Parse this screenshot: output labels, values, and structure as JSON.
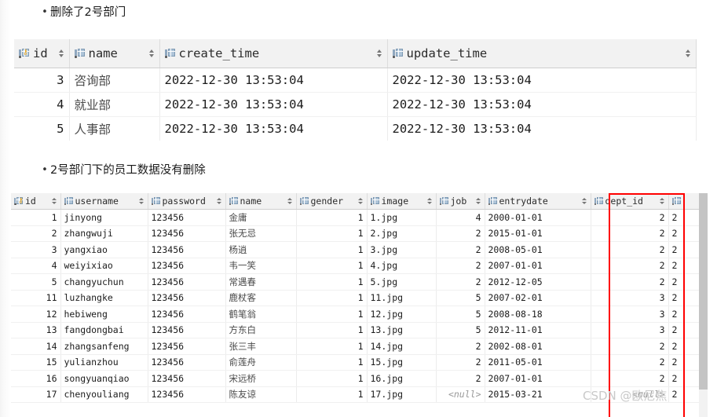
{
  "notes": [
    {
      "text": "删除了2号部门"
    },
    {
      "text": "2号部门下的员工数据没有删除"
    }
  ],
  "dept_table": {
    "columns": [
      {
        "label": "id",
        "icon": "primary-key-column-icon",
        "sortable": true
      },
      {
        "label": "name",
        "icon": "column-icon",
        "sortable": true
      },
      {
        "label": "create_time",
        "icon": "column-icon",
        "sortable": true
      },
      {
        "label": "update_time",
        "icon": "column-icon",
        "sortable": true
      }
    ],
    "rows": [
      {
        "id": "3",
        "name": "咨询部",
        "create_time": "2022-12-30 13:53:04",
        "update_time": "2022-12-30 13:53:04"
      },
      {
        "id": "4",
        "name": "就业部",
        "create_time": "2022-12-30 13:53:04",
        "update_time": "2022-12-30 13:53:04"
      },
      {
        "id": "5",
        "name": "人事部",
        "create_time": "2022-12-30 13:53:04",
        "update_time": "2022-12-30 13:53:04"
      }
    ]
  },
  "emp_table": {
    "columns": [
      {
        "label": "id",
        "icon": "primary-key-column-icon",
        "sortable": true
      },
      {
        "label": "username",
        "icon": "column-icon",
        "sortable": true
      },
      {
        "label": "password",
        "icon": "column-icon",
        "sortable": true
      },
      {
        "label": "name",
        "icon": "column-icon",
        "sortable": true
      },
      {
        "label": "gender",
        "icon": "column-icon",
        "sortable": true
      },
      {
        "label": "image",
        "icon": "column-icon",
        "sortable": true
      },
      {
        "label": "job",
        "icon": "column-icon",
        "sortable": true
      },
      {
        "label": "entrydate",
        "icon": "column-icon",
        "sortable": true
      },
      {
        "label": "dept_id",
        "icon": "column-icon",
        "sortable": true
      }
    ],
    "rows": [
      {
        "id": "1",
        "username": "jinyong",
        "password": "123456",
        "name": "金庸",
        "gender": "1",
        "image": "1.jpg",
        "job": "4",
        "entrydate": "2000-01-01",
        "dept_id": "2",
        "next": "2"
      },
      {
        "id": "2",
        "username": "zhangwuji",
        "password": "123456",
        "name": "张无忌",
        "gender": "1",
        "image": "2.jpg",
        "job": "2",
        "entrydate": "2015-01-01",
        "dept_id": "2",
        "next": "2"
      },
      {
        "id": "3",
        "username": "yangxiao",
        "password": "123456",
        "name": "杨逍",
        "gender": "1",
        "image": "3.jpg",
        "job": "2",
        "entrydate": "2008-05-01",
        "dept_id": "2",
        "next": "2"
      },
      {
        "id": "4",
        "username": "weiyixiao",
        "password": "123456",
        "name": "韦一笑",
        "gender": "1",
        "image": "4.jpg",
        "job": "2",
        "entrydate": "2007-01-01",
        "dept_id": "2",
        "next": "2"
      },
      {
        "id": "5",
        "username": "changyuchun",
        "password": "123456",
        "name": "常遇春",
        "gender": "1",
        "image": "5.jpg",
        "job": "2",
        "entrydate": "2012-12-05",
        "dept_id": "2",
        "next": "2"
      },
      {
        "id": "11",
        "username": "luzhangke",
        "password": "123456",
        "name": "鹿杖客",
        "gender": "1",
        "image": "11.jpg",
        "job": "5",
        "entrydate": "2007-02-01",
        "dept_id": "3",
        "next": "2"
      },
      {
        "id": "12",
        "username": "hebiweng",
        "password": "123456",
        "name": "鹤笔翁",
        "gender": "1",
        "image": "12.jpg",
        "job": "5",
        "entrydate": "2008-08-18",
        "dept_id": "3",
        "next": "2"
      },
      {
        "id": "13",
        "username": "fangdongbai",
        "password": "123456",
        "name": "方东白",
        "gender": "1",
        "image": "13.jpg",
        "job": "5",
        "entrydate": "2012-11-01",
        "dept_id": "3",
        "next": "2"
      },
      {
        "id": "14",
        "username": "zhangsanfeng",
        "password": "123456",
        "name": "张三丰",
        "gender": "1",
        "image": "14.jpg",
        "job": "2",
        "entrydate": "2002-08-01",
        "dept_id": "2",
        "next": "2"
      },
      {
        "id": "15",
        "username": "yulianzhou",
        "password": "123456",
        "name": "俞莲舟",
        "gender": "1",
        "image": "15.jpg",
        "job": "2",
        "entrydate": "2011-05-01",
        "dept_id": "2",
        "next": "2"
      },
      {
        "id": "16",
        "username": "songyuanqiao",
        "password": "123456",
        "name": "宋远桥",
        "gender": "1",
        "image": "16.jpg",
        "job": "2",
        "entrydate": "2007-01-01",
        "dept_id": "2",
        "next": "2"
      },
      {
        "id": "17",
        "username": "chenyouliang",
        "password": "123456",
        "name": "陈友谅",
        "gender": "1",
        "image": "17.jpg",
        "job": "<null>",
        "entrydate": "2015-03-21",
        "dept_id": "<null>",
        "next": "2"
      }
    ],
    "highlight_column": "dept_id",
    "highlight_color": "#ff0000"
  },
  "watermark": {
    "text": "CSDN @欧尼焦"
  }
}
